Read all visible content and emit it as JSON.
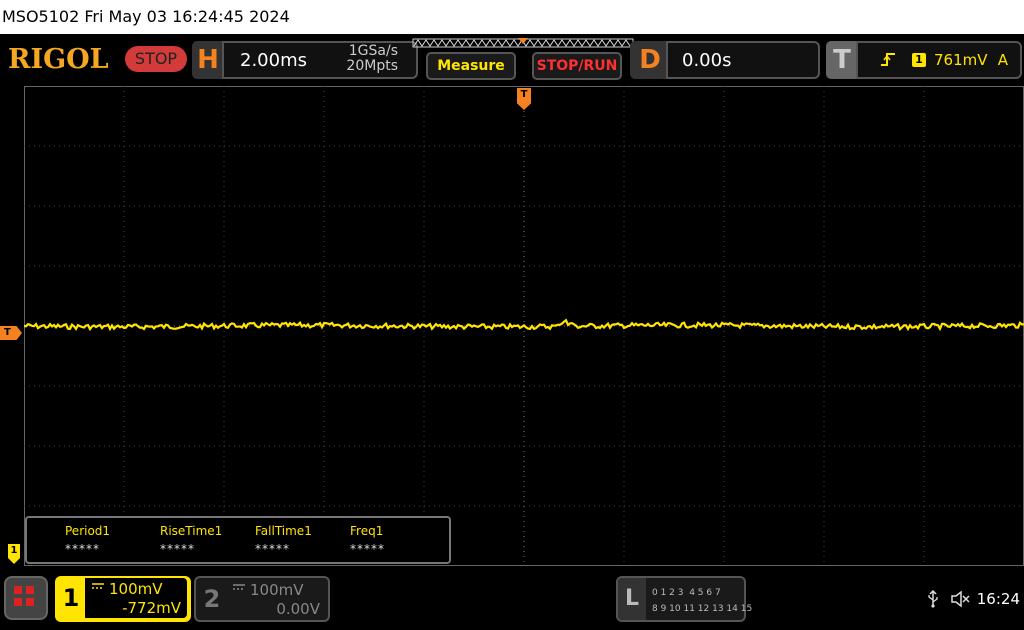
{
  "titlebar": {
    "text": "MSO5102  Fri May 03 16:24:45 2024"
  },
  "header": {
    "logo": "RIGOL",
    "run_state": "STOP",
    "horizontal": {
      "letter": "H",
      "timebase": "2.00ms",
      "sample_rate": "1GSa/s",
      "memory_depth": "20Mpts"
    },
    "measure_label": "Measure",
    "stoprun_label": "STOP/RUN",
    "delay": {
      "letter": "D",
      "value": "0.00s"
    },
    "trigger": {
      "letter": "T",
      "slope_icon": "rising-edge-icon",
      "source": "1",
      "level": "761mV",
      "mode": "A"
    }
  },
  "markers": {
    "trigger_level": "T",
    "trigger_position": "T",
    "ch1": "1"
  },
  "measurements": [
    {
      "name": "Period1",
      "value": "*****"
    },
    {
      "name": "RiseTime1",
      "value": "*****"
    },
    {
      "name": "FallTime1",
      "value": "*****"
    },
    {
      "name": "Freq1",
      "value": "*****"
    }
  ],
  "channels": {
    "ch1": {
      "number": "1",
      "coupling_icon": "dc-coupling-icon",
      "scale": "100mV",
      "offset": "-772mV"
    },
    "ch2": {
      "number": "2",
      "coupling_icon": "dc-coupling-icon",
      "scale": "100mV",
      "offset": "0.00V"
    }
  },
  "logic": {
    "letter": "L",
    "row1": "0 1 2 3  4 5 6 7",
    "row2": "8 9 10 11 12 13 14 15"
  },
  "status": {
    "time": "16:24",
    "icons": [
      "usb-icon",
      "speaker-mute-icon"
    ]
  },
  "colors": {
    "ch1": "#ffe500",
    "trigger": "#f58220",
    "stop": "#d33a3a",
    "grid": "#555555"
  }
}
